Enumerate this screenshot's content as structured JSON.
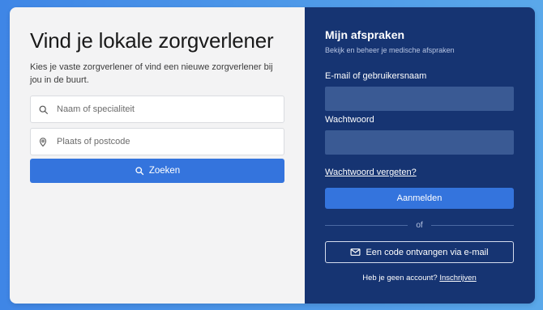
{
  "search_panel": {
    "title": "Vind je lokale zorgverlener",
    "subtitle": "Kies je vaste zorgverlener of vind een nieuwe zorgverlener bij jou in de buurt.",
    "name_placeholder": "Naam of specialiteit",
    "location_placeholder": "Plaats of postcode",
    "search_button": "Zoeken",
    "icons": {
      "name": "search-icon",
      "location": "map-pin-icon",
      "button": "search-icon"
    }
  },
  "login_panel": {
    "title": "Mijn afspraken",
    "subtitle": "Bekijk en beheer je medische afspraken",
    "email_label": "E-mail of gebruikersnaam",
    "password_label": "Wachtwoord",
    "forgot_link": "Wachtwoord vergeten?",
    "login_button": "Aanmelden",
    "divider_text": "of",
    "code_button": "Een code ontvangen via e-mail",
    "code_icon": "mail-icon",
    "no_account_text": "Heb je geen account?",
    "signup_link": "Inschrijven"
  },
  "colors": {
    "background_gradient_start": "#3f86e6",
    "background_gradient_end": "#5aa8ea",
    "left_panel": "#f3f3f4",
    "right_panel": "#163472",
    "primary_button": "#3474dd",
    "input_dark": "#3a5a94"
  }
}
